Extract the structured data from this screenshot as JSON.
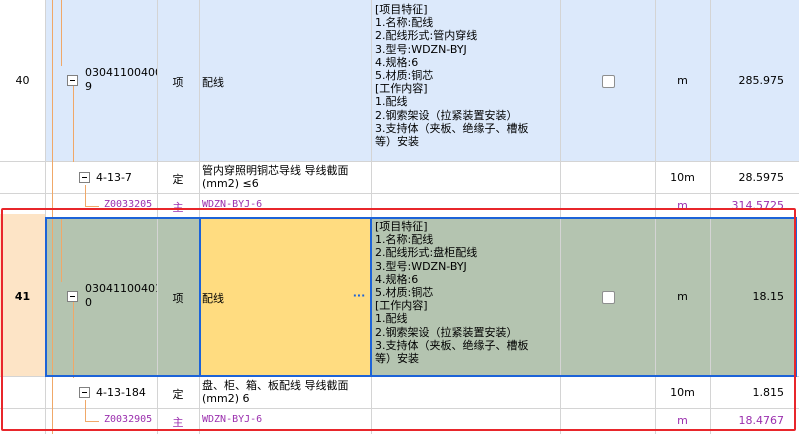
{
  "rows": {
    "r40": {
      "index": "40",
      "code": "03041100400\n9",
      "type": "项",
      "name": "配线",
      "features": "[项目特征]\n1.名称:配线\n2.配线形式:管内穿线\n3.型号:WDZN-BYJ\n4.规格:6\n5.材质:铜芯\n[工作内容]\n1.配线\n2.钢索架设（拉紧装置安装）\n3.支持体（夹板、绝缘子、槽板\n等）安装",
      "unit": "m",
      "qty": "285.975"
    },
    "r40a": {
      "code": "4-13-7",
      "type": "定",
      "name": "管内穿照明铜芯导线 导线截面\n(mm2) ≤6",
      "unit": "10m",
      "qty": "28.5975"
    },
    "r40b": {
      "code": "Z0033205",
      "type": "主",
      "name": "WDZN-BYJ-6",
      "unit": "m",
      "qty": "314.5725"
    },
    "r41": {
      "index": "41",
      "code": "03041100401\n0",
      "type": "项",
      "name": "配线",
      "ellipsis": "···",
      "features": "[项目特征]\n1.名称:配线\n2.配线形式:盘柜配线\n3.型号:WDZN-BYJ\n4.规格:6\n5.材质:铜芯\n[工作内容]\n1.配线\n2.钢索架设（拉紧装置安装）\n3.支持体（夹板、绝缘子、槽板\n等）安装",
      "unit": "m",
      "qty": "18.15"
    },
    "r41a": {
      "code": "4-13-184",
      "type": "定",
      "name": "盘、柜、箱、板配线 导线截面\n(mm2) 6",
      "unit": "10m",
      "qty": "1.815"
    },
    "r41b": {
      "code": "Z0032905",
      "type": "主",
      "name": "WDZN-BYJ-6",
      "unit": "m",
      "qty": "18.4767"
    }
  },
  "colors": {
    "blue_row": "#dce9fb",
    "selected_row": "#b4c4b0",
    "active_cell": "#ffdc80",
    "index_highlight": "#fde4c6",
    "annotation_red": "#e8262b",
    "focus_blue": "#1c63d8"
  }
}
